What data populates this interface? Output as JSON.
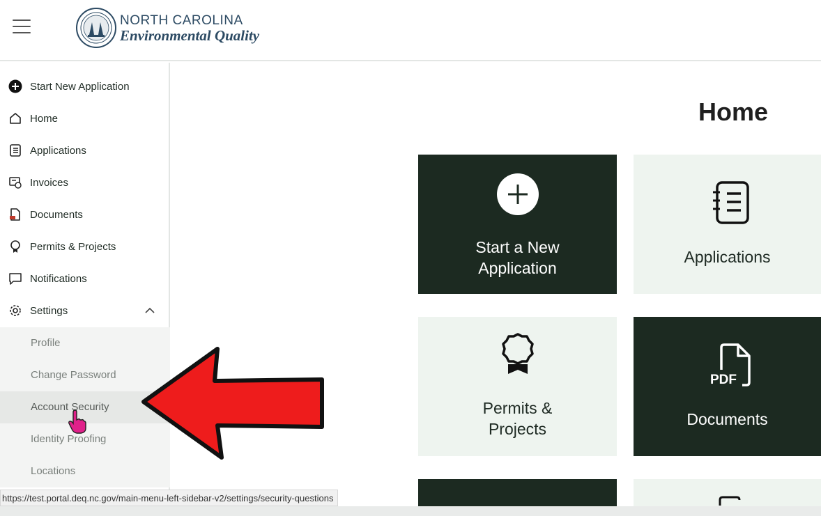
{
  "header": {
    "menu_icon": "hamburger-icon",
    "logo_icon": "nc-state-seal-icon",
    "brand_top": "NORTH CAROLINA",
    "brand_bottom": "Environmental Quality"
  },
  "sidebar": {
    "items": [
      {
        "label": "Start New Application",
        "icon": "plus-circle-icon"
      },
      {
        "label": "Home",
        "icon": "home-icon"
      },
      {
        "label": "Applications",
        "icon": "list-notebook-icon"
      },
      {
        "label": "Invoices",
        "icon": "invoice-icon"
      },
      {
        "label": "Documents",
        "icon": "pdf-document-icon"
      },
      {
        "label": "Permits & Projects",
        "icon": "award-ribbon-icon"
      },
      {
        "label": "Notifications",
        "icon": "speech-bubble-icon"
      },
      {
        "label": "Settings",
        "icon": "gear-icon",
        "expanded": true
      }
    ],
    "settings_sub": [
      "Profile",
      "Change Password",
      "Account Security",
      "Identity Proofing",
      "Locations"
    ],
    "active_sub": "Account Security"
  },
  "main": {
    "title": "Home",
    "tiles": [
      {
        "label_line1": "Start a New",
        "label_line2": "Application",
        "icon": "plus-circle-icon"
      },
      {
        "label_line1": "Applications",
        "icon": "list-notebook-icon"
      },
      {
        "label_line1": "Permits &",
        "label_line2": "Projects",
        "icon": "award-ribbon-icon"
      },
      {
        "label_line1": "Documents",
        "icon": "pdf-document-icon"
      }
    ]
  },
  "status_url": "https://test.portal.deq.nc.gov/main-menu-left-sidebar-v2/settings/security-questions",
  "colors": {
    "dark_tile": "#1c2a21",
    "light_tile": "#eef4ef",
    "brand_text": "#2c4a63",
    "annotation_arrow": "#ee1c1c"
  }
}
